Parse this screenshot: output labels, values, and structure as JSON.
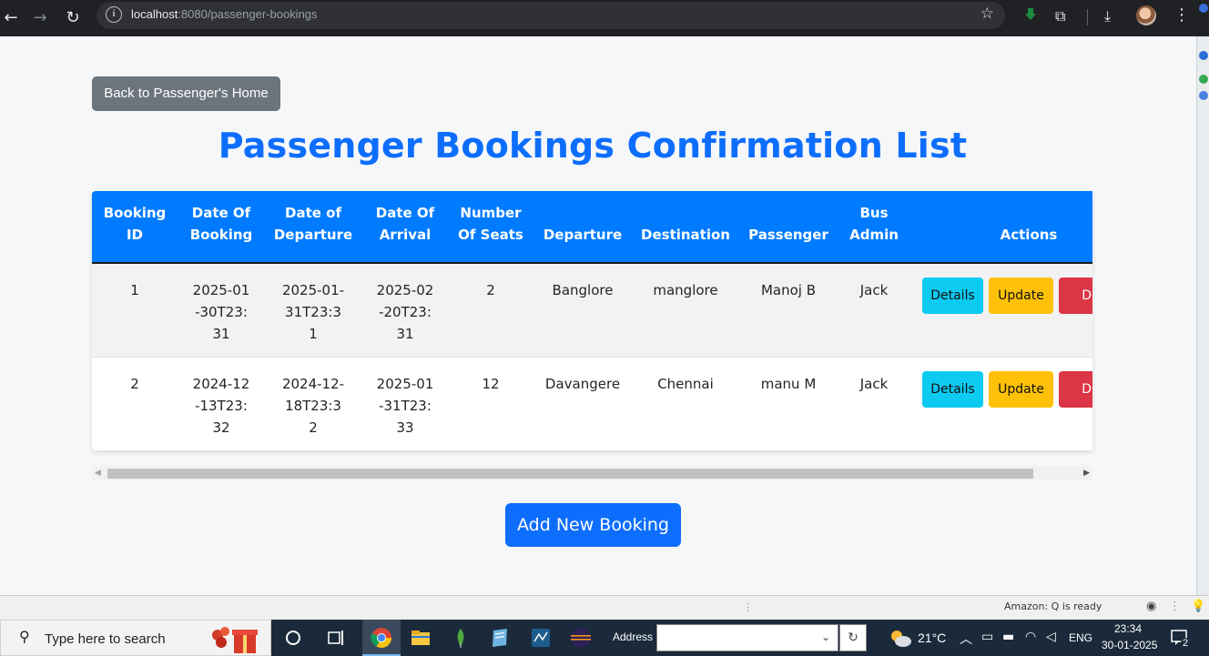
{
  "browser": {
    "url_host": "localhost",
    "url_path": ":8080/passenger-bookings"
  },
  "page": {
    "back_label": "Back to Passenger's Home",
    "title": "Passenger Bookings Confirmation List",
    "add_label": "Add New Booking"
  },
  "table": {
    "headers": [
      "Booking ID",
      "Date Of Booking",
      "Date of Departure",
      "Date Of Arrival",
      "Number Of Seats",
      "Departure",
      "Destination",
      "Passenger",
      "Bus Admin",
      "Actions"
    ],
    "rows": [
      {
        "id": "1",
        "booking": "2025-01-30T23:31",
        "departure_date": "2025-01-31T23:31",
        "arrival": "2025-02-20T23:31",
        "seats": "2",
        "from": "Banglore",
        "to": "manglore",
        "passenger": "Manoj B",
        "admin": "Jack"
      },
      {
        "id": "2",
        "booking": "2024-12-13T23:32",
        "departure_date": "2024-12-18T23:32",
        "arrival": "2025-01-31T23:33",
        "seats": "12",
        "from": "Davangere",
        "to": "Chennai",
        "passenger": "manu M",
        "admin": "Jack"
      }
    ],
    "actions": {
      "details": "Details",
      "update": "Update",
      "delete": "De"
    }
  },
  "statusbar": {
    "text": "Amazon: Q is ready"
  },
  "taskbar": {
    "search_placeholder": "Type here to search",
    "address_label": "Address",
    "temperature": "21°C",
    "language": "ENG",
    "time": "23:34",
    "date": "30-01-2025",
    "notification_count": "2"
  },
  "colors": {
    "primary": "#0d6efd",
    "header": "#007bff",
    "secondary": "#6c757d",
    "info": "#0dcaf0",
    "warning": "#ffc107",
    "danger": "#dc3545"
  }
}
